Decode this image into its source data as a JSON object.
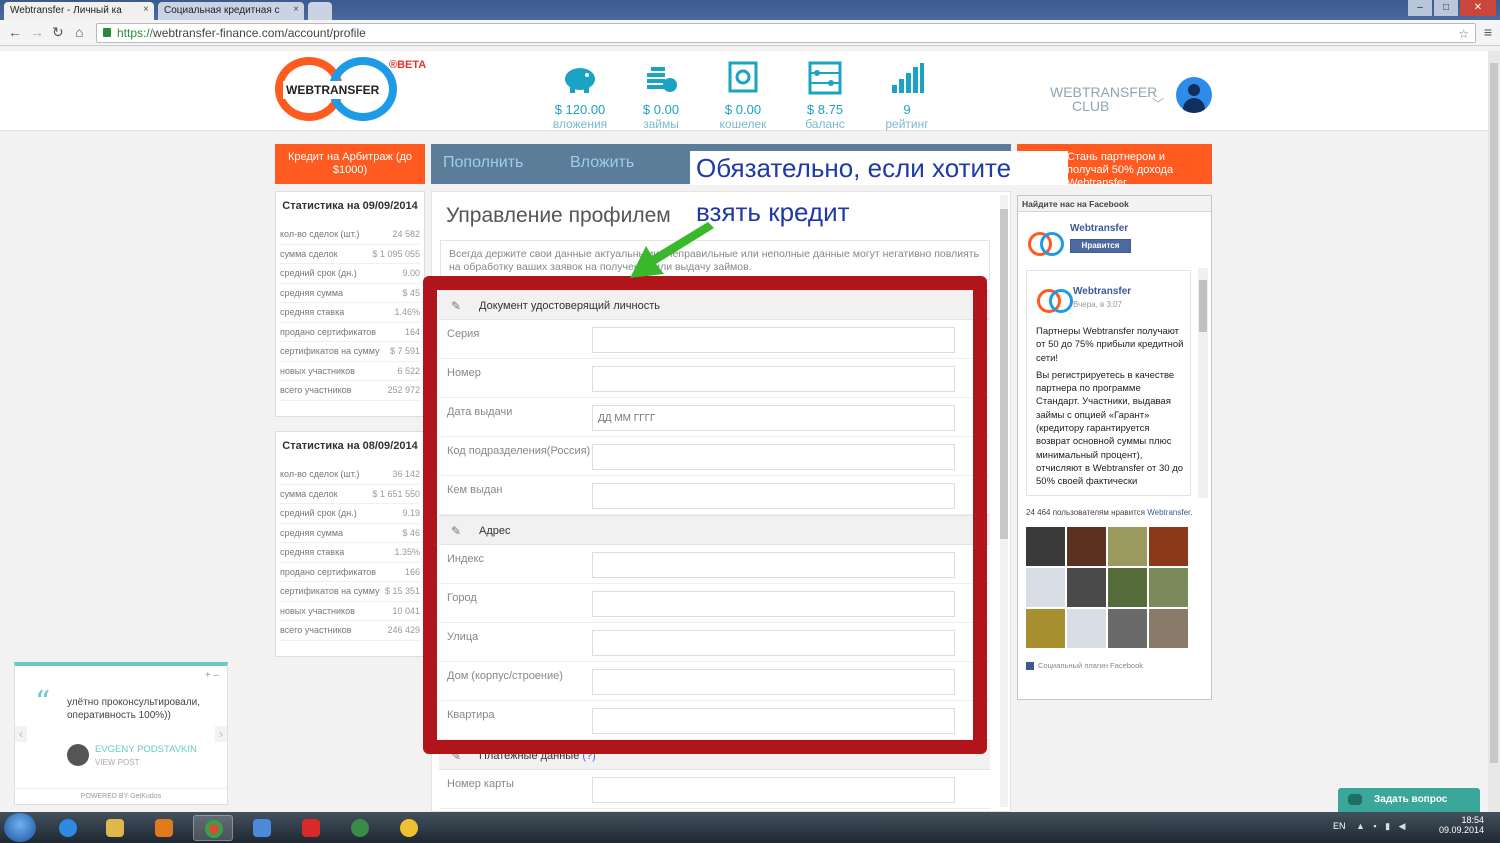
{
  "browser": {
    "tabs": [
      {
        "title": "Webtransfer - Личный ка"
      },
      {
        "title": "Социальная кредитная с"
      }
    ],
    "url_scheme": "https://",
    "url_rest": "webtransfer-finance.com/account/profile"
  },
  "header": {
    "logo_text": "WEBTRANSFER",
    "beta": "®BETA",
    "stats": [
      {
        "value": "$ 120.00",
        "label": "вложения",
        "icon": "piggy-bank-icon"
      },
      {
        "value": "$ 0.00",
        "label": "займы",
        "icon": "coins-icon"
      },
      {
        "value": "$ 0.00",
        "label": "кошелек",
        "icon": "safe-icon"
      },
      {
        "value": "$ 8.75",
        "label": "баланс",
        "icon": "abacus-icon"
      },
      {
        "value": "9",
        "label": "рейтинг",
        "icon": "rating-chart-icon"
      }
    ],
    "club_line1": "WEBTRANSFER",
    "club_line2": "CLUB"
  },
  "left": {
    "credit_button": "Кредит на Арбитраж (до $1000)",
    "stats_today": {
      "title": "Статистика на 09/09/2014",
      "rows": [
        {
          "label": "кол-во сделок (шт.)",
          "value": "24 582"
        },
        {
          "label": "сумма сделок",
          "value": "$ 1 095 055"
        },
        {
          "label": "средний срок (дн.)",
          "value": "9.00"
        },
        {
          "label": "средняя сумма",
          "value": "$ 45"
        },
        {
          "label": "средняя ставка",
          "value": "1.46%"
        },
        {
          "label": "продано сертификатов",
          "value": "164"
        },
        {
          "label": "сертификатов на сумму",
          "value": "$ 7 591"
        },
        {
          "label": "новых участников",
          "value": "6 522"
        },
        {
          "label": "всего участников",
          "value": "252 972"
        }
      ]
    },
    "stats_prev": {
      "title": "Статистика на 08/09/2014",
      "rows": [
        {
          "label": "кол-во сделок (шт.)",
          "value": "36 142"
        },
        {
          "label": "сумма сделок",
          "value": "$ 1 651 550"
        },
        {
          "label": "средний срок (дн.)",
          "value": "9.19"
        },
        {
          "label": "средняя сумма",
          "value": "$ 46"
        },
        {
          "label": "средняя ставка",
          "value": "1.35%"
        },
        {
          "label": "продано сертификатов",
          "value": "166"
        },
        {
          "label": "сертификатов на сумму",
          "value": "$ 15 351"
        },
        {
          "label": "новых участников",
          "value": "10 041"
        },
        {
          "label": "всего участников",
          "value": "246 429"
        }
      ]
    }
  },
  "nav": {
    "topup": "Пополнить",
    "invest": "Вложить"
  },
  "annotation": {
    "line1": "Обязательно, если хотите",
    "line2": "взять кредит"
  },
  "main": {
    "title": "Управление профилем",
    "note": "Всегда держите свои данные актуальными. Неправильные или неполные данные могут негативно повлиять на обработку ваших заявок на получение или выдачу займов.",
    "section_id": "Документ удостоверящий личность",
    "id_fields": [
      {
        "label": "Серия",
        "value": ""
      },
      {
        "label": "Номер",
        "value": ""
      },
      {
        "label": "Дата выдачи",
        "value": "",
        "placeholder": "ДД ММ ГГГГ"
      },
      {
        "label": "Код подразделения(Россия)",
        "value": ""
      },
      {
        "label": "Кем выдан",
        "value": ""
      }
    ],
    "section_address": "Адрес",
    "address_fields": [
      {
        "label": "Индекс",
        "value": ""
      },
      {
        "label": "Город",
        "value": ""
      },
      {
        "label": "Улица",
        "value": ""
      },
      {
        "label": "Дом (корпус/строение)",
        "value": ""
      },
      {
        "label": "Квартира",
        "value": ""
      }
    ],
    "section_payment": "Платежные данные",
    "payment_help": "(?)",
    "payment_fields": [
      {
        "label": "Номер карты",
        "value": ""
      }
    ]
  },
  "right": {
    "partner_button": "Стань партнером и получай 50% дохода Webtransfer",
    "fb_title": "Найдите нас на Facebook",
    "fb_page_name": "Webtransfer",
    "fb_like": "Нравится",
    "post_author": "Webtransfer",
    "post_time": "Вчера, в 3:07",
    "post_p1": "Партнеры Webtransfer получают от 50 до 75% прибыли кредитной сети!",
    "post_p2": "Вы регистрируетесь в качестве партнера по программе Стандарт. Участники, выдавая займы с опцией «Гарант» (кредитору гарантируется возврат основной суммы плюс минимальный процент), отчисляют в Webtransfer от 30 до 50% своей фактически",
    "likes_count": "24 464 пользователям нравится",
    "likes_link": "Webtransfer.",
    "footer": "Социальный плагин Facebook"
  },
  "kudos": {
    "text": "улётно проконсультировали, оперативность 100%))",
    "author": "EVGENY PODSTAVKIN",
    "view": "VIEW POST",
    "powered": "POWERED BY GetKudos"
  },
  "ask_button": "Задать вопрос",
  "taskbar": {
    "lang": "EN",
    "time": "18:54",
    "date": "09.09.2014"
  },
  "colors": {
    "orange": "#ff5a1f",
    "blue_logo": "#1e9be6",
    "annotation_red": "#b1141a",
    "annotation_text": "#1f3aa6",
    "nav_bg": "#5b7d99",
    "arrow_green": "#38b82a"
  }
}
